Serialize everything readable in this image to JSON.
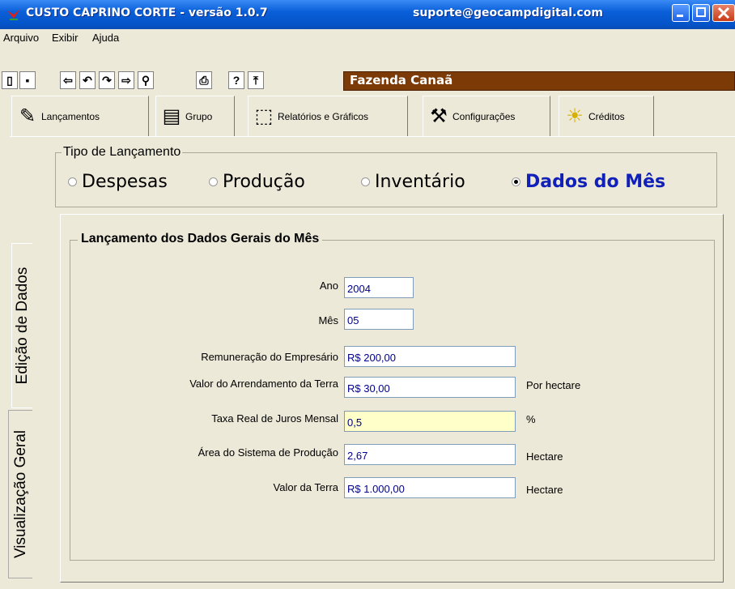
{
  "window": {
    "title": "CUSTO CAPRINO CORTE - versão 1.0.7",
    "email": "suporte@geocampdigital.com"
  },
  "menu": [
    "Arquivo",
    "Exibir",
    "Ajuda"
  ],
  "toolbar": {
    "farm_name": "Fazenda Canaã",
    "icons": [
      "new-icon",
      "save-icon",
      "back-icon",
      "undo-icon",
      "redo-icon",
      "forward-icon",
      "find-icon",
      "print-icon",
      "help-icon",
      "folder-up-icon"
    ]
  },
  "tabs": [
    {
      "label": "Lançamentos",
      "icon": "feather-icon",
      "active": true
    },
    {
      "label": "Grupo",
      "icon": "notebook-icon"
    },
    {
      "label": "Relatórios e Gráficos",
      "icon": "chart-icon"
    },
    {
      "label": "Configurações",
      "icon": "wrench-icon"
    },
    {
      "label": "Créditos",
      "icon": "sun-icon"
    }
  ],
  "tipo": {
    "legend": "Tipo de Lançamento",
    "options": [
      "Despesas",
      "Produção",
      "Inventário",
      "Dados do Mês"
    ],
    "selected": "Dados do Mês"
  },
  "side_tabs": {
    "edicao": "Edição de Dados",
    "visualizacao": "Visualização Geral"
  },
  "form": {
    "legend": "Lançamento dos Dados Gerais do Mês",
    "fields": [
      {
        "label": "Ano",
        "value": "2004",
        "unit": ""
      },
      {
        "label": "Mês",
        "value": "05",
        "unit": ""
      },
      {
        "label": "Remuneração do Empresário",
        "value": "R$ 200,00",
        "unit": ""
      },
      {
        "label": "Valor do Arrendamento da Terra",
        "value": "R$ 30,00",
        "unit": "Por hectare"
      },
      {
        "label": "Taxa Real de Juros Mensal",
        "value": "0,5",
        "unit": "%"
      },
      {
        "label": "Área do Sistema de Produção",
        "value": "2,67",
        "unit": "Hectare"
      },
      {
        "label": "Valor da Terra",
        "value": "R$ 1.000,00",
        "unit": "Hectare"
      }
    ]
  },
  "colors": {
    "title_bar": "#0a5fd8",
    "farm_bar": "#7b3a06",
    "selected_radio": "#1020b8",
    "highlight_field": "#ffffc9"
  }
}
